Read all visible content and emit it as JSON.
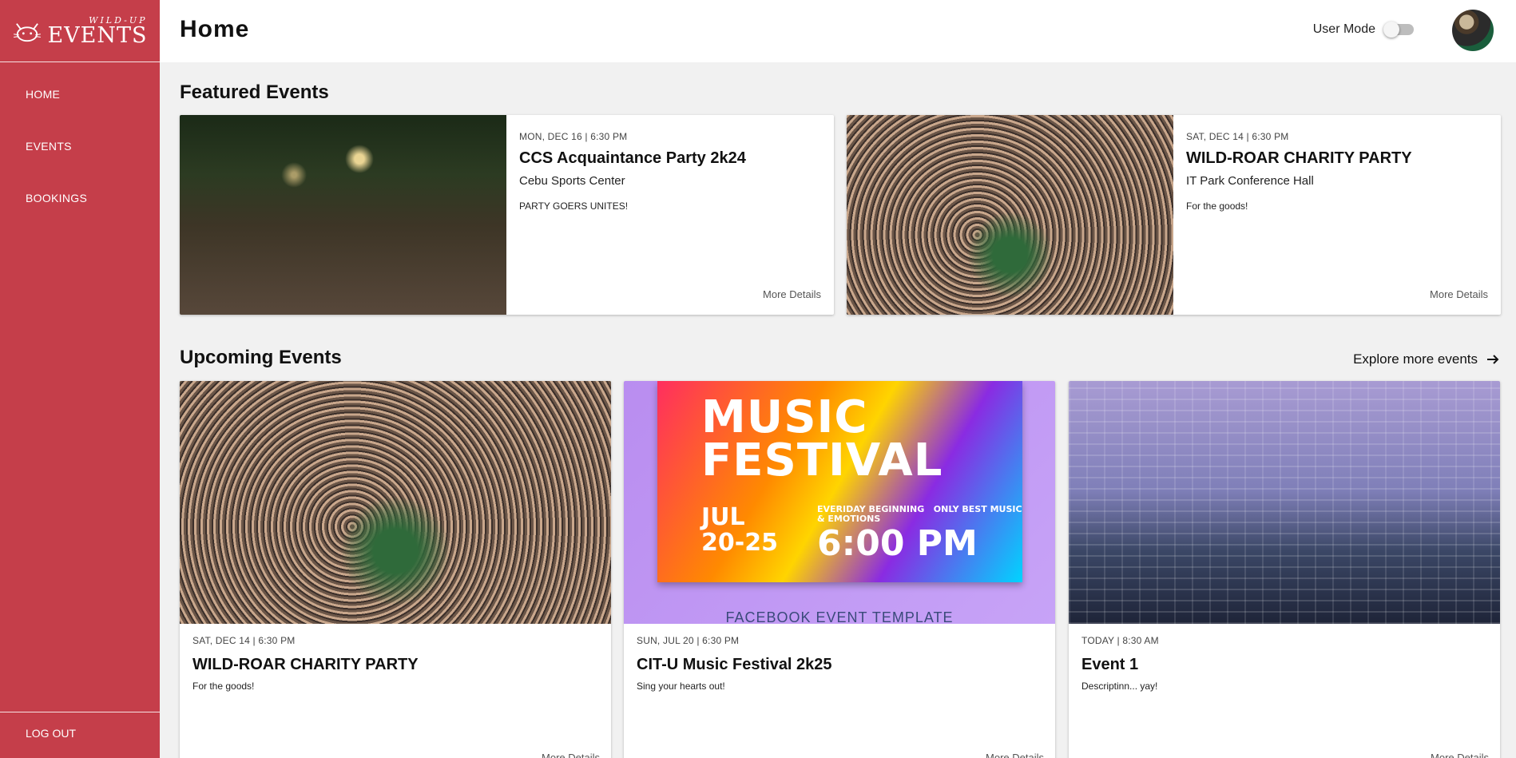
{
  "sidebar": {
    "logo_small": "WILD-UP",
    "logo_big": "EVENTS",
    "items": [
      {
        "label": "HOME"
      },
      {
        "label": "EVENTS"
      },
      {
        "label": "BOOKINGS"
      }
    ],
    "logout_label": "LOG OUT"
  },
  "header": {
    "title": "Home",
    "user_mode_label": "User Mode",
    "user_mode_on": false
  },
  "featured": {
    "section_title": "Featured Events",
    "cards": [
      {
        "date": "MON, DEC 16 | 6:30 PM",
        "title": "CCS Acquaintance Party 2k24",
        "venue": "Cebu Sports Center",
        "description": "PARTY GOERS UNITES!",
        "more": "More Details"
      },
      {
        "date": "SAT, DEC 14 | 6:30 PM",
        "title": "WILD-ROAR CHARITY PARTY",
        "venue": "IT Park Conference Hall",
        "description": "For the goods!",
        "more": "More Details"
      }
    ]
  },
  "upcoming": {
    "section_title": "Upcoming Events",
    "explore_label": "Explore more events",
    "cards": [
      {
        "date": "SAT, DEC 14 | 6:30 PM",
        "title": "WILD-ROAR CHARITY PARTY",
        "description": "For the goods!",
        "more": "More Details"
      },
      {
        "date": "SUN, JUL 20 | 6:30 PM",
        "title": "CIT-U Music Festival 2k25",
        "description": "Sing your hearts out!",
        "more": "More Details"
      },
      {
        "date": "TODAY | 8:30 AM",
        "title": "Event 1",
        "description": "Descriptinn... yay!",
        "more": "More Details"
      }
    ],
    "music_poster": {
      "line1": "MUSIC",
      "line2": "FESTIVAL",
      "month": "JUL",
      "days": "20-25",
      "tag1": "EVERIDAY BEGINNING",
      "tag2": "ONLY BEST MUSIC & EMOTIONS",
      "time": "6:00 PM",
      "caption": "FACEBOOK EVENT TEMPLATE"
    }
  },
  "colors": {
    "sidebar": "#c53e4a",
    "background": "#f1f1f1",
    "card": "#ffffff"
  }
}
